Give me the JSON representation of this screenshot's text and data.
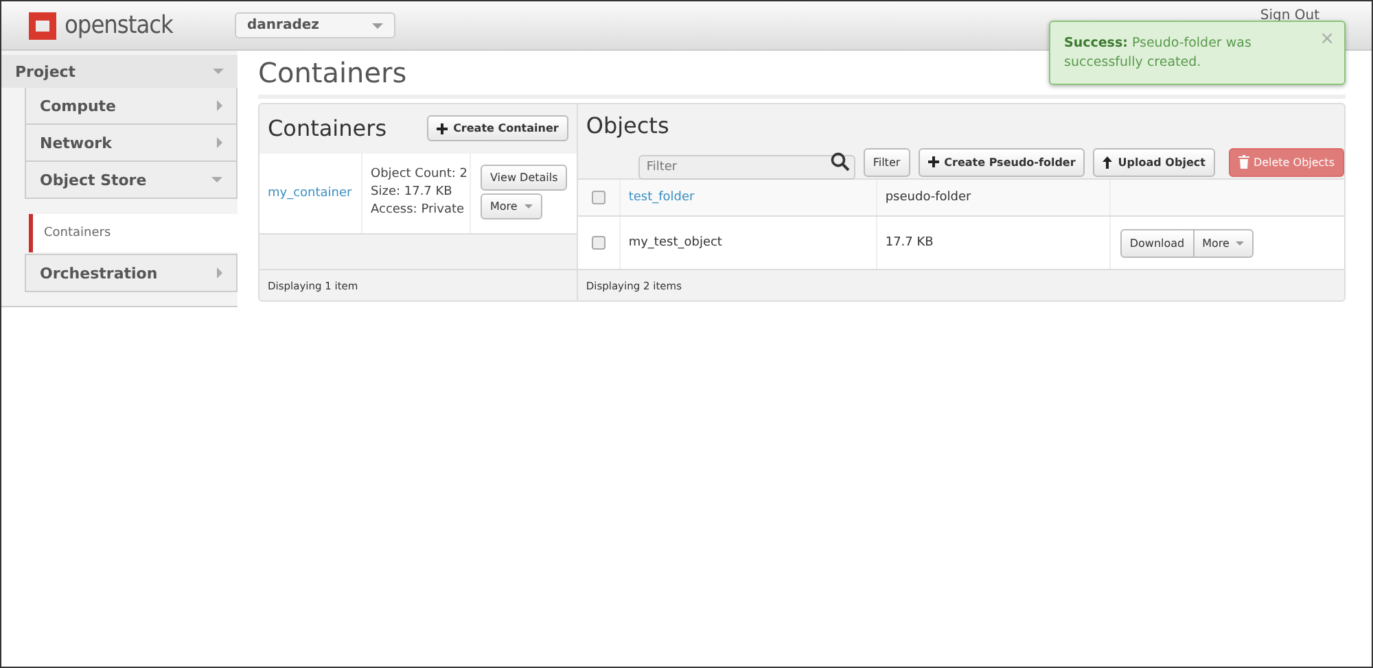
{
  "header": {
    "brand": "openstack",
    "project_selector": "danradez",
    "sign_out": "Sign Out"
  },
  "alert": {
    "message": "**Success:** Pseudo-folder was successfully created.",
    "close": "×"
  },
  "sidebar": {
    "section": {
      "label": "Project",
      "expanded": true
    },
    "items": [
      {
        "label": "Compute",
        "expanded": false
      },
      {
        "label": "Network",
        "expanded": false
      },
      {
        "label": "Object Store",
        "expanded": true,
        "children": [
          {
            "label": "Containers",
            "selected": true
          }
        ]
      },
      {
        "label": "Orchestration",
        "expanded": false
      }
    ]
  },
  "page_title": "Containers",
  "containers": {
    "title": "Containers",
    "create_button": "Create Container",
    "rows": [
      {
        "name": "my_container",
        "details": [
          "Object Count: 2",
          "Size: 17.7 KB",
          "Access: Private"
        ],
        "actions": [
          "View Details",
          "More"
        ]
      }
    ],
    "footer": "Displaying 1 item"
  },
  "objects": {
    "title": "Objects",
    "filter_placeholder": "Filter",
    "filter_button": "Filter",
    "create_button": "Create Pseudo-folder",
    "upload_button": "Upload Object",
    "delete_button": {
      "label": "Delete Objects",
      "disabled": true
    },
    "rows": [
      {
        "checked": false,
        "name": "test_folder",
        "kind": "folder",
        "size": "pseudo-folder"
      },
      {
        "checked": false,
        "name": "my_test_object",
        "kind": "object",
        "size": "17.7 KB",
        "actions": [
          "Download",
          "More"
        ]
      }
    ],
    "footer": "Displaying 2 items"
  }
}
